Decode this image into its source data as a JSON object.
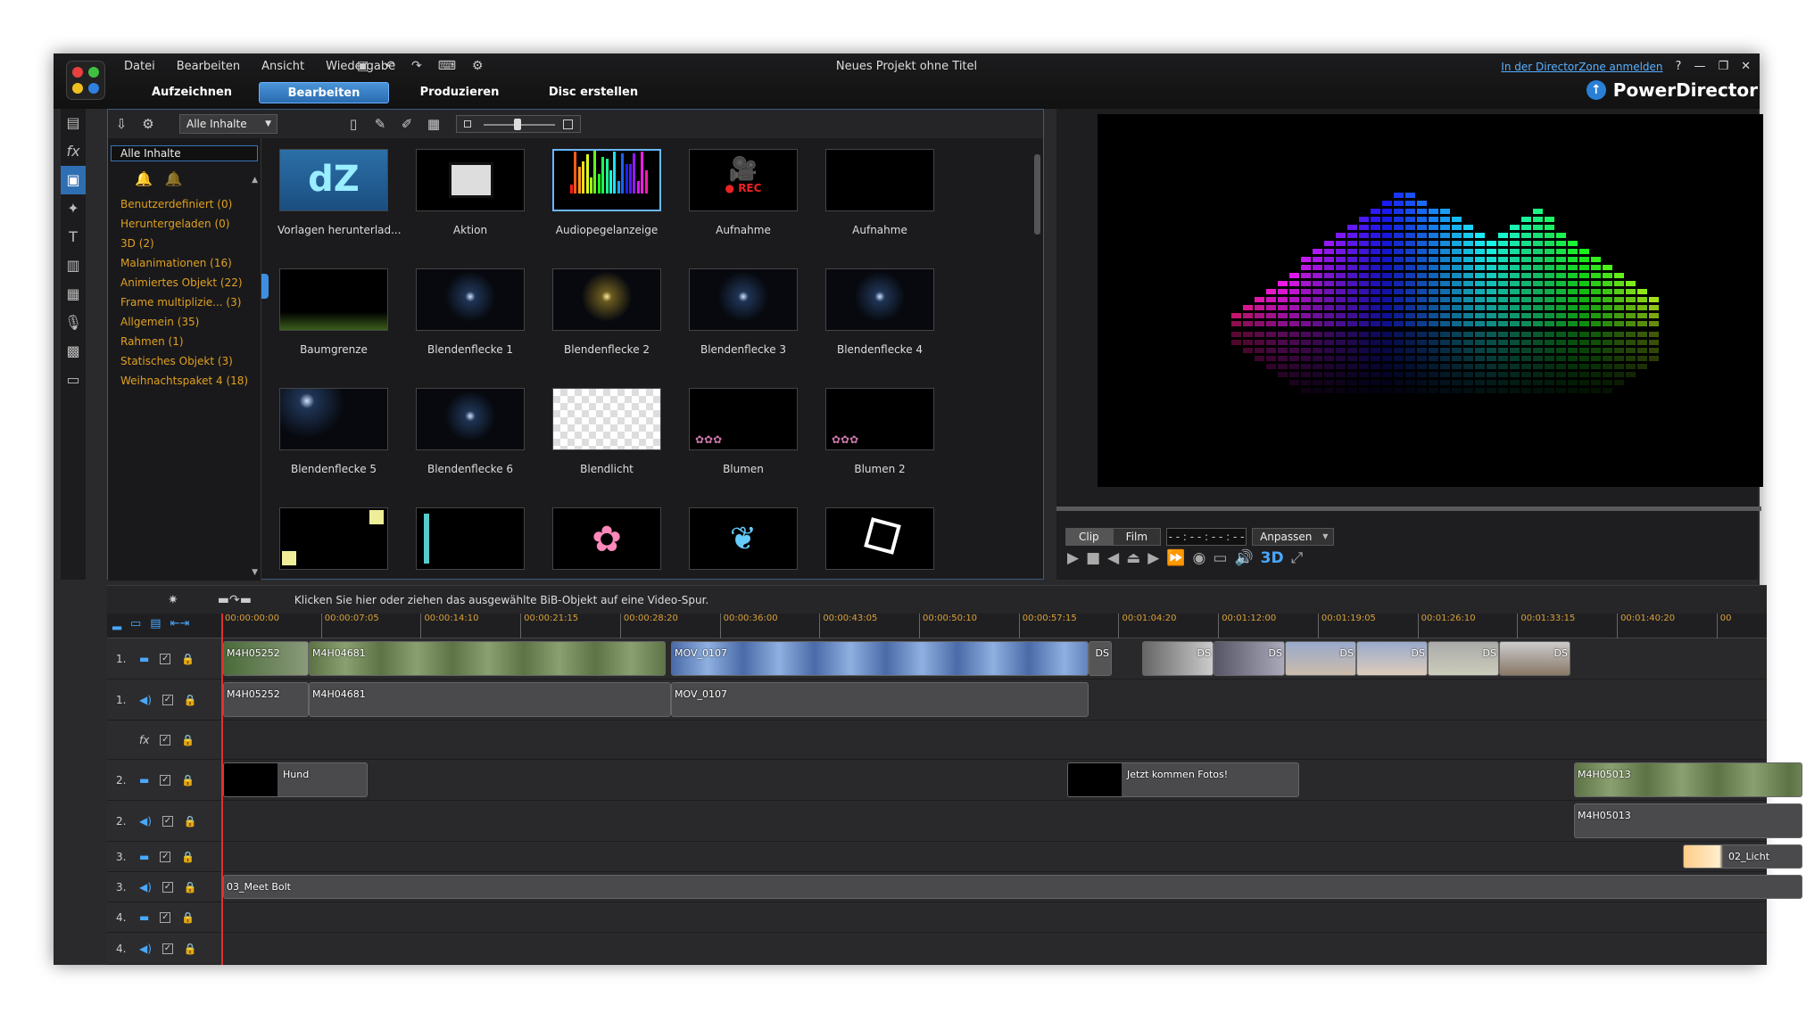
{
  "window": {
    "title": "Neues Projekt ohne Titel",
    "brand": "PowerDirector",
    "dz_link": "In der DirectorZone anmelden"
  },
  "menu": [
    "Datei",
    "Bearbeiten",
    "Ansicht",
    "Wiedergabe"
  ],
  "modes": [
    {
      "label": "Aufzeichnen"
    },
    {
      "label": "Bearbeiten",
      "active": true
    },
    {
      "label": "Produzieren"
    },
    {
      "label": "Disc erstellen"
    }
  ],
  "library": {
    "filter": "Alle Inhalte",
    "search": "Alle Inhalte",
    "categories": [
      "Benutzerdefiniert (0)",
      "Heruntergeladen (0)",
      "3D (2)",
      "Malanimationen (16)",
      "Animiertes Objekt (22)",
      "Frame multiplizie... (3)",
      "Allgemein (35)",
      "Rahmen (1)",
      "Statisches Objekt (3)",
      "Weihnachtspaket 4 (18)"
    ],
    "items": [
      "Vorlagen herunterlad...",
      "Aktion",
      "Audiopegelanzeige",
      "Aufnahme",
      "Aufnahme",
      "Baumgrenze",
      "Blendenflecke 1",
      "Blendenflecke 2",
      "Blendenflecke 3",
      "Blendenflecke 4",
      "Blendenflecke 5",
      "Blendenflecke 6",
      "Blendlicht",
      "Blumen",
      "Blumen 2",
      "",
      "",
      "",
      "",
      ""
    ],
    "selected_index": 2
  },
  "preview": {
    "clip_tab": "Clip",
    "film_tab": "Film",
    "timecode": "- - : - - : - - : - -",
    "fit": "Anpassen",
    "mode3d": "3D"
  },
  "hint": "Klicken Sie hier oder ziehen das ausgewählte BiB-Objekt auf eine Video-Spur.",
  "timeline": {
    "ticks": [
      "00:00:00:00",
      "00:00:07:05",
      "00:00:14:10",
      "00:00:21:15",
      "00:00:28:20",
      "00:00:36:00",
      "00:00:43:05",
      "00:00:50:10",
      "00:00:57:15",
      "00:01:04:20",
      "00:01:12:00",
      "00:01:19:05",
      "00:01:26:10",
      "00:01:33:15",
      "00:01:40:20",
      "00"
    ],
    "track_labels": [
      "1.",
      "1.",
      "",
      "2.",
      "2.",
      "3.",
      "3.",
      "4.",
      "4."
    ],
    "clips": {
      "v1a": "M4H05252",
      "v1b": "M4H04681",
      "v1c": "MOV_0107",
      "a1a": "M4H05252",
      "a1b": "M4H04681",
      "a1c": "MOV_0107",
      "ds": "DS",
      "v2a": "Hund",
      "v2b": "Jetzt kommen Fotos!",
      "v2c": "M4H05013",
      "a2a": "M4H05013",
      "v3a": "02_Licht",
      "a3a": "03_Meet Bolt"
    }
  }
}
